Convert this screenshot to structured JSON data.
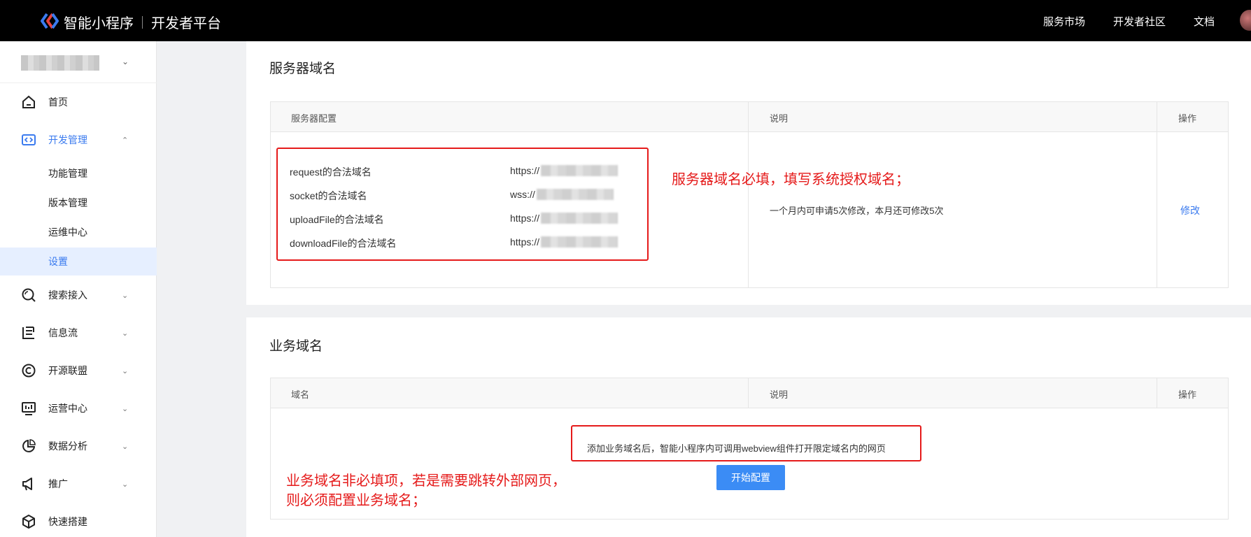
{
  "header": {
    "brand": "智能小程序",
    "platform": "开发者平台",
    "nav": [
      "服务市场",
      "开发者社区",
      "文档"
    ]
  },
  "sidebar": {
    "items": [
      {
        "label": "首页",
        "icon": "home-icon"
      },
      {
        "label": "开发管理",
        "icon": "code-icon",
        "expanded": true,
        "children": [
          {
            "label": "功能管理"
          },
          {
            "label": "版本管理"
          },
          {
            "label": "运维中心"
          },
          {
            "label": "设置",
            "selected": true
          }
        ]
      },
      {
        "label": "搜索接入",
        "icon": "search-icon"
      },
      {
        "label": "信息流",
        "icon": "feed-icon"
      },
      {
        "label": "开源联盟",
        "icon": "copyright-icon"
      },
      {
        "label": "运营中心",
        "icon": "dashboard-icon"
      },
      {
        "label": "数据分析",
        "icon": "pie-chart-icon"
      },
      {
        "label": "推广",
        "icon": "megaphone-icon"
      },
      {
        "label": "快速搭建",
        "icon": "cube-icon"
      }
    ]
  },
  "server_domain": {
    "title": "服务器域名",
    "headers": {
      "config": "服务器配置",
      "desc": "说明",
      "action": "操作"
    },
    "rows": [
      {
        "label": "request的合法域名",
        "value": "https://"
      },
      {
        "label": "socket的合法域名",
        "value": "wss://"
      },
      {
        "label": "uploadFile的合法域名",
        "value": "https://"
      },
      {
        "label": "downloadFile的合法域名",
        "value": "https://"
      }
    ],
    "description": "一个月内可申请5次修改，本月还可修改5次",
    "action_label": "修改",
    "annotation": "服务器域名必填，填写系统授权域名；"
  },
  "business_domain": {
    "title": "业务域名",
    "headers": {
      "domain": "域名",
      "desc": "说明",
      "action": "操作"
    },
    "description": "添加业务域名后，智能小程序内可调用webview组件打开限定域名内的网页",
    "button_label": "开始配置",
    "annotation_line1": "业务域名非必填项，若是需要跳转外部网页，",
    "annotation_line2": "则必须配置业务域名；"
  },
  "colors": {
    "accent": "#3b7bef",
    "annotation": "#e51a1a",
    "topbar": "#000000"
  }
}
